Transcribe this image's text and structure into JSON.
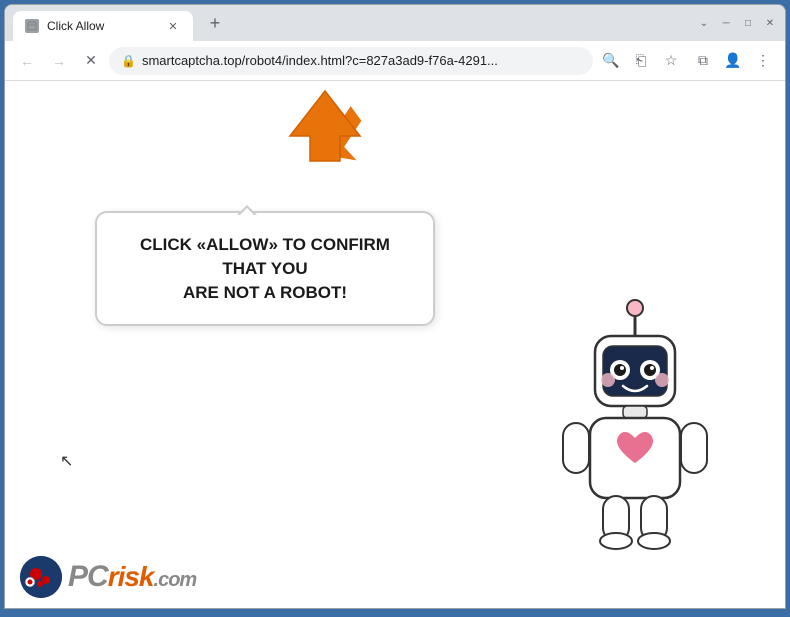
{
  "window": {
    "title": "Click Allow",
    "tab_title": "Click Allow",
    "new_tab_label": "+",
    "controls": {
      "minimize": "─",
      "maximize": "□",
      "close": "✕"
    }
  },
  "addressbar": {
    "back_label": "←",
    "forward_label": "→",
    "reload_label": "✕",
    "url": "smartcaptcha.top/robot4/index.html?c=827a3ad9-f76a-4291...",
    "lock_icon": "🔒",
    "search_icon": "🔍",
    "share_icon": "⎗",
    "bookmark_icon": "☆",
    "extensions_icon": "⧉",
    "profile_icon": "👤",
    "menu_icon": "⋮"
  },
  "page": {
    "bubble_text_line1": "CLICK «ALLOW» TO CONFIRM THAT YOU",
    "bubble_text_line2": "ARE NOT A ROBOT!"
  },
  "pcrisk": {
    "text": "PC",
    "risk": "risk",
    "com": ".com"
  }
}
